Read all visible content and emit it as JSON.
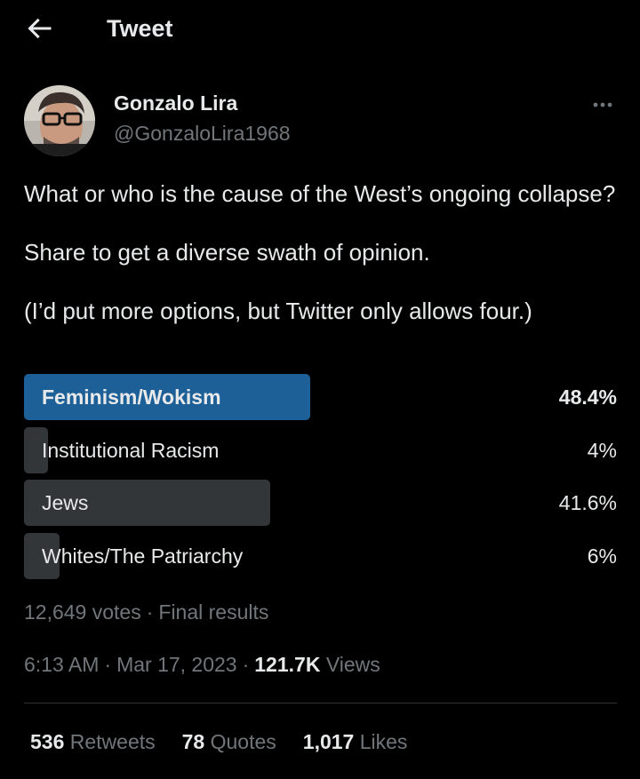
{
  "header": {
    "back_icon": "arrow-left-icon",
    "title": "Tweet"
  },
  "author": {
    "name": "Gonzalo Lira",
    "handle": "@GonzaloLira1968",
    "more_icon": "more-horizontal-icon"
  },
  "tweet": {
    "line1": "What or who is the cause of the West’s ongoing collapse?",
    "line2": "Share to get a diverse swath of opinion.",
    "line3": "(I’d put more options, but Twitter only allows four.)"
  },
  "poll": {
    "options": [
      {
        "label": "Feminism/Wokism",
        "percent_text": "48.4%",
        "percent": 48.4,
        "winner": true
      },
      {
        "label": "Institutional Racism",
        "percent_text": "4%",
        "percent": 4,
        "winner": false
      },
      {
        "label": "Jews",
        "percent_text": "41.6%",
        "percent": 41.6,
        "winner": false
      },
      {
        "label": "Whites/The Patriarchy",
        "percent_text": "6%",
        "percent": 6,
        "winner": false
      }
    ],
    "votes": "12,649 votes",
    "status": "Final results"
  },
  "meta": {
    "time": "6:13 AM",
    "date": "Mar 17, 2023",
    "views_count": "121.7K",
    "views_label": "Views"
  },
  "stats": {
    "retweets_count": "536",
    "retweets_label": "Retweets",
    "quotes_count": "78",
    "quotes_label": "Quotes",
    "likes_count": "1,017",
    "likes_label": "Likes"
  },
  "colors": {
    "background": "#000000",
    "text": "#e7e9ea",
    "muted": "#71767b",
    "poll_winner": "#1d5f97",
    "poll_bar": "#333639"
  }
}
